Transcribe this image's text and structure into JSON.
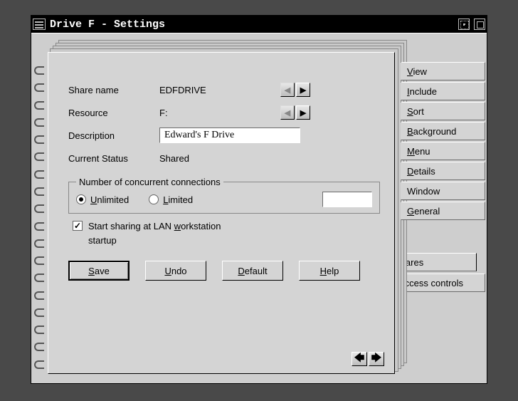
{
  "window": {
    "title": "Drive F - Settings"
  },
  "form": {
    "share_name": {
      "label": "Share name",
      "value": "EDFDRIVE"
    },
    "resource": {
      "label": "Resource",
      "value": "F:"
    },
    "description": {
      "label": "Description",
      "value": "Edward's F Drive"
    },
    "status": {
      "label": "Current Status",
      "value": "Shared"
    }
  },
  "connections": {
    "legend": "Number of concurrent connections",
    "unlimited_label": "nlimited",
    "limited_label": "imited",
    "selection": "unlimited",
    "limit_value": ""
  },
  "autostart": {
    "checked": true,
    "line1_pre": "Start sharing at LAN ",
    "line1_u": "w",
    "line1_post": "orkstation",
    "line2": "startup"
  },
  "buttons": {
    "save": "ave",
    "undo": "ndo",
    "default": "efault",
    "help": "elp"
  },
  "tabs": {
    "primary": [
      {
        "u": "V",
        "rest": "iew"
      },
      {
        "u": "I",
        "rest": "nclude"
      },
      {
        "u": "S",
        "rest": "ort"
      },
      {
        "u": "B",
        "rest": "ackground"
      },
      {
        "u": "M",
        "rest": "enu"
      },
      {
        "u": "D",
        "rest": "etails"
      },
      {
        "u": "",
        "rest": "Window"
      },
      {
        "u": "G",
        "rest": "eneral"
      }
    ],
    "secondary": [
      {
        "u": "S",
        "rest": "hares",
        "active": true
      },
      {
        "u": "A",
        "rest": "ccess controls"
      }
    ]
  }
}
